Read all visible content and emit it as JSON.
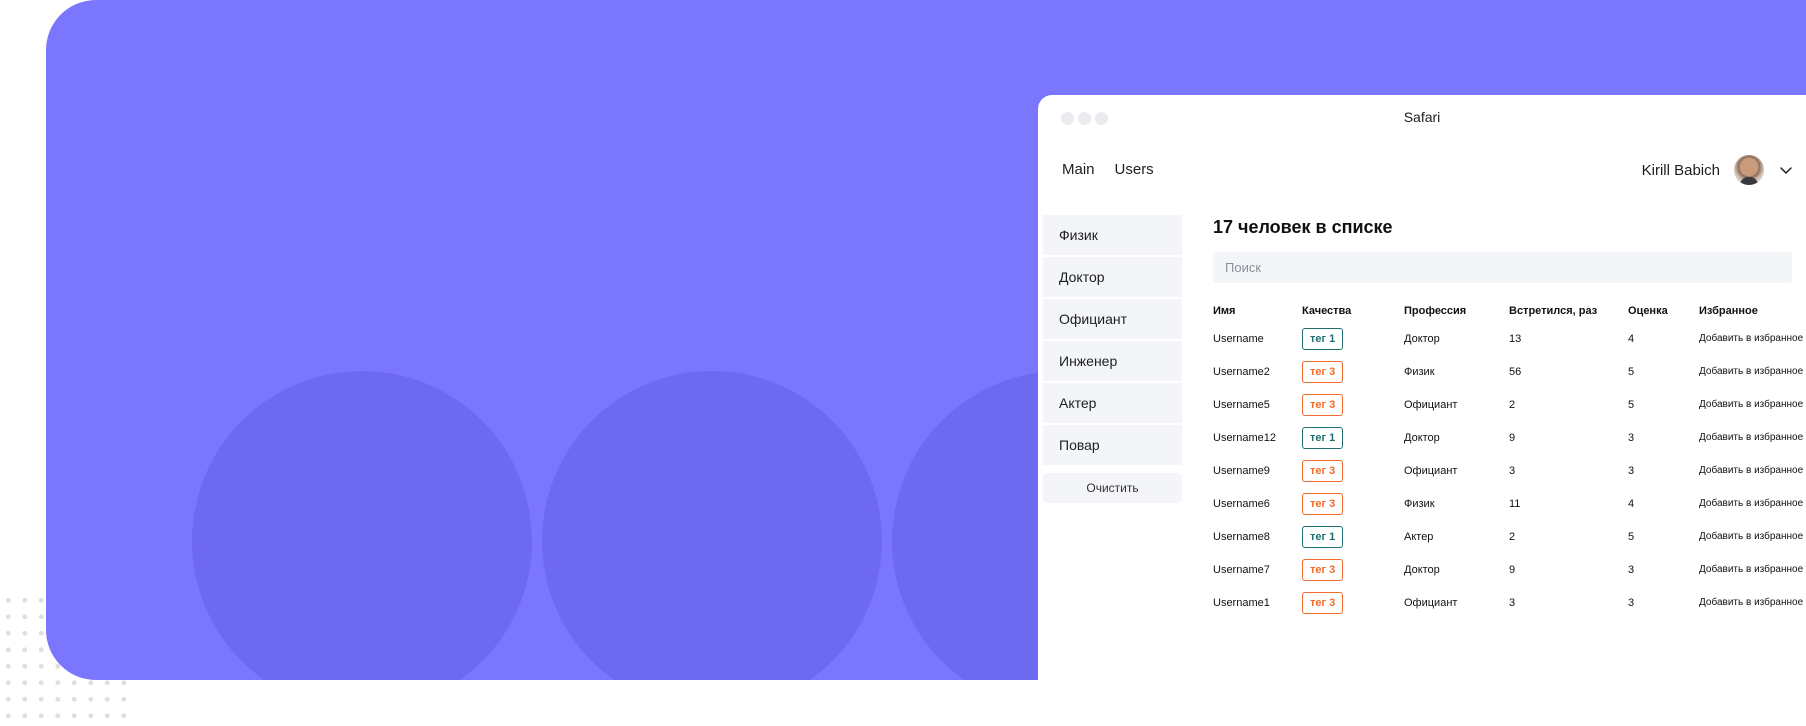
{
  "window": {
    "title": "Safari"
  },
  "nav": {
    "items": [
      "Main",
      "Users"
    ]
  },
  "user": {
    "name": "Kirill Babich"
  },
  "sidebar": {
    "items": [
      "Физик",
      "Доктор",
      "Официант",
      "Инженер",
      "Актер",
      "Повар"
    ],
    "clear_label": "Очистить"
  },
  "main": {
    "heading": "17 человек в списке",
    "search_placeholder": "Поиск"
  },
  "table": {
    "headers": [
      "Имя",
      "Качества",
      "Профессия",
      "Встретился, раз",
      "Оценка",
      "Избранное"
    ],
    "rows": [
      {
        "name": "Username",
        "tag": "тег 1",
        "profession": "Доктор",
        "met": "13",
        "rating": "4",
        "fav": "Добавить в избранное"
      },
      {
        "name": "Username2",
        "tag": "тег 3",
        "profession": "Физик",
        "met": "56",
        "rating": "5",
        "fav": "Добавить в избранное"
      },
      {
        "name": "Username5",
        "tag": "тег 3",
        "profession": "Официант",
        "met": "2",
        "rating": "5",
        "fav": "Добавить в избранное"
      },
      {
        "name": "Username12",
        "tag": "тег 1",
        "profession": "Доктор",
        "met": "9",
        "rating": "3",
        "fav": "Добавить в избранное"
      },
      {
        "name": "Username9",
        "tag": "тег 3",
        "profession": "Официант",
        "met": "3",
        "rating": "3",
        "fav": "Добавить в избранное"
      },
      {
        "name": "Username6",
        "tag": "тег 3",
        "profession": "Физик",
        "met": "11",
        "rating": "4",
        "fav": "Добавить в избранное"
      },
      {
        "name": "Username8",
        "tag": "тег 1",
        "profession": "Актер",
        "met": "2",
        "rating": "5",
        "fav": "Добавить в избранное"
      },
      {
        "name": "Username7",
        "tag": "тег 3",
        "profession": "Доктор",
        "met": "9",
        "rating": "3",
        "fav": "Добавить в избранное"
      },
      {
        "name": "Username1",
        "tag": "тег 3",
        "profession": "Официант",
        "met": "3",
        "rating": "3",
        "fav": "Добавить в избранное"
      }
    ]
  },
  "colors": {
    "hero_background": "#7a76fe",
    "hero_circles": "#6e69f1",
    "tag_1": "#1f6e70",
    "tag_3": "#f36a2d",
    "panel_background": "#f3f5f8"
  },
  "icons": {
    "dropdown": "chevron-down-icon",
    "avatar": "user-avatar"
  }
}
